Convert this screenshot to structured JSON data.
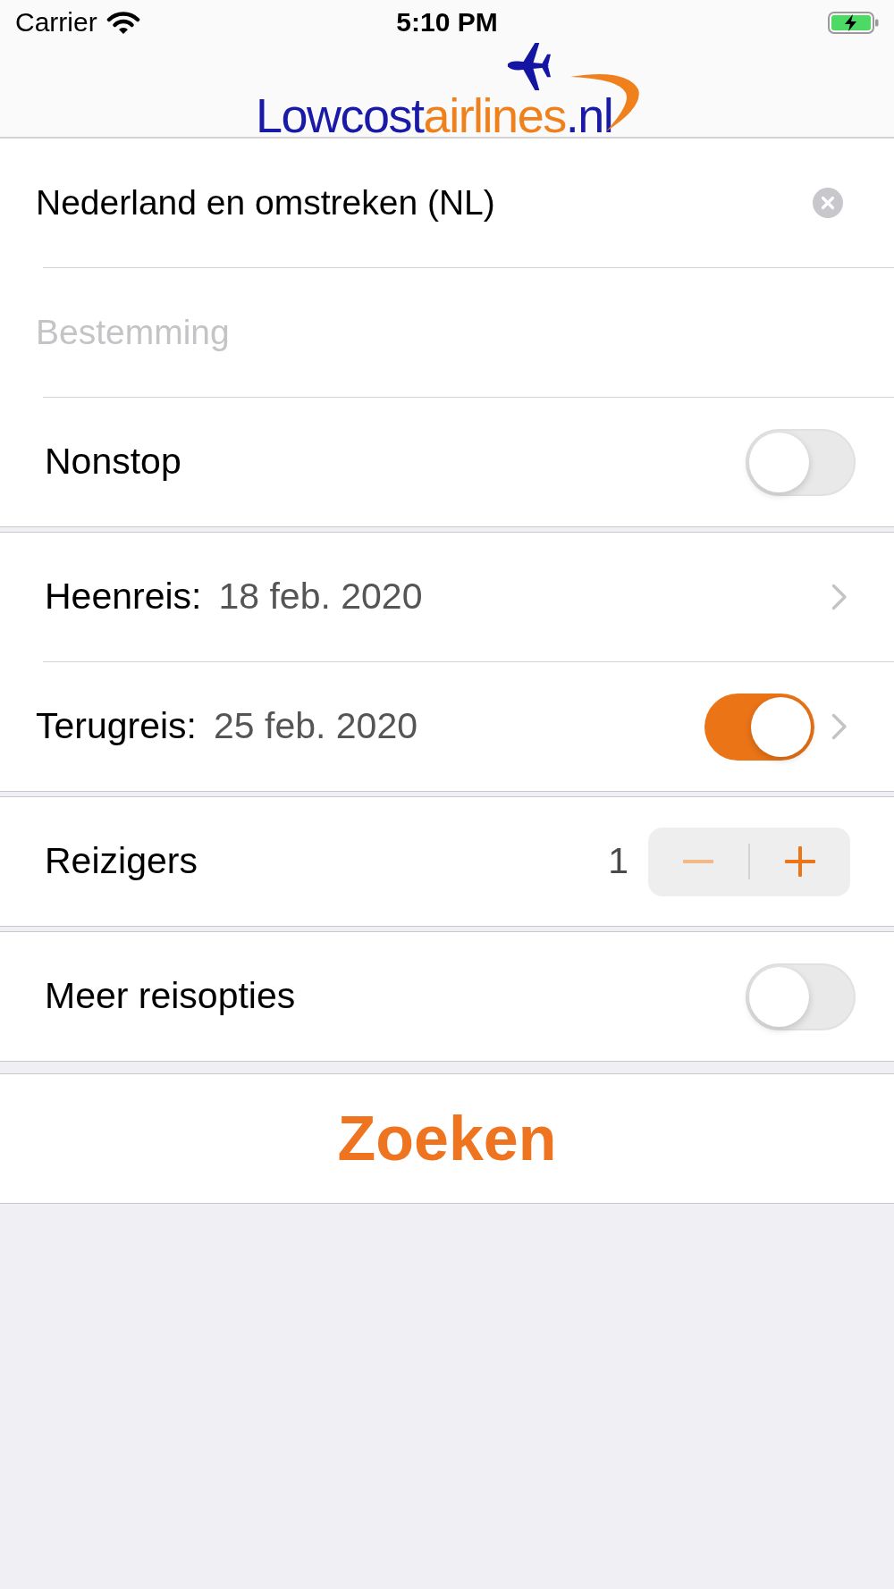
{
  "status_bar": {
    "carrier": "Carrier",
    "time": "5:10 PM"
  },
  "logo": {
    "parts": [
      {
        "text": "Lowcost",
        "color": "#1a1aa8"
      },
      {
        "text": "airlines",
        "color": "#ef801c"
      },
      {
        "text": ".nl",
        "color": "#1a1aa8"
      }
    ]
  },
  "sections": [
    {
      "rows": [
        {
          "kind": "text_field",
          "value": "Nederland en omstreken (NL)",
          "clear_button": true
        },
        {
          "kind": "text_field",
          "placeholder": "Bestemming"
        },
        {
          "kind": "toggle",
          "label": "Nonstop",
          "on": false
        }
      ]
    },
    {
      "rows": [
        {
          "kind": "date",
          "label": "Heenreis:",
          "value": "18 feb. 2020"
        },
        {
          "kind": "date_toggle",
          "label": "Terugreis:",
          "value": "25 feb. 2020",
          "on": true
        }
      ]
    },
    {
      "rows": [
        {
          "kind": "stepper",
          "label": "Reizigers",
          "value": "1",
          "decrement_disabled": true,
          "increment_disabled": false
        }
      ]
    },
    {
      "rows": [
        {
          "kind": "toggle",
          "label": "Meer reisopties",
          "on": false
        }
      ]
    },
    {
      "rows": [
        {
          "kind": "button",
          "label": "Zoeken"
        }
      ]
    }
  ]
}
